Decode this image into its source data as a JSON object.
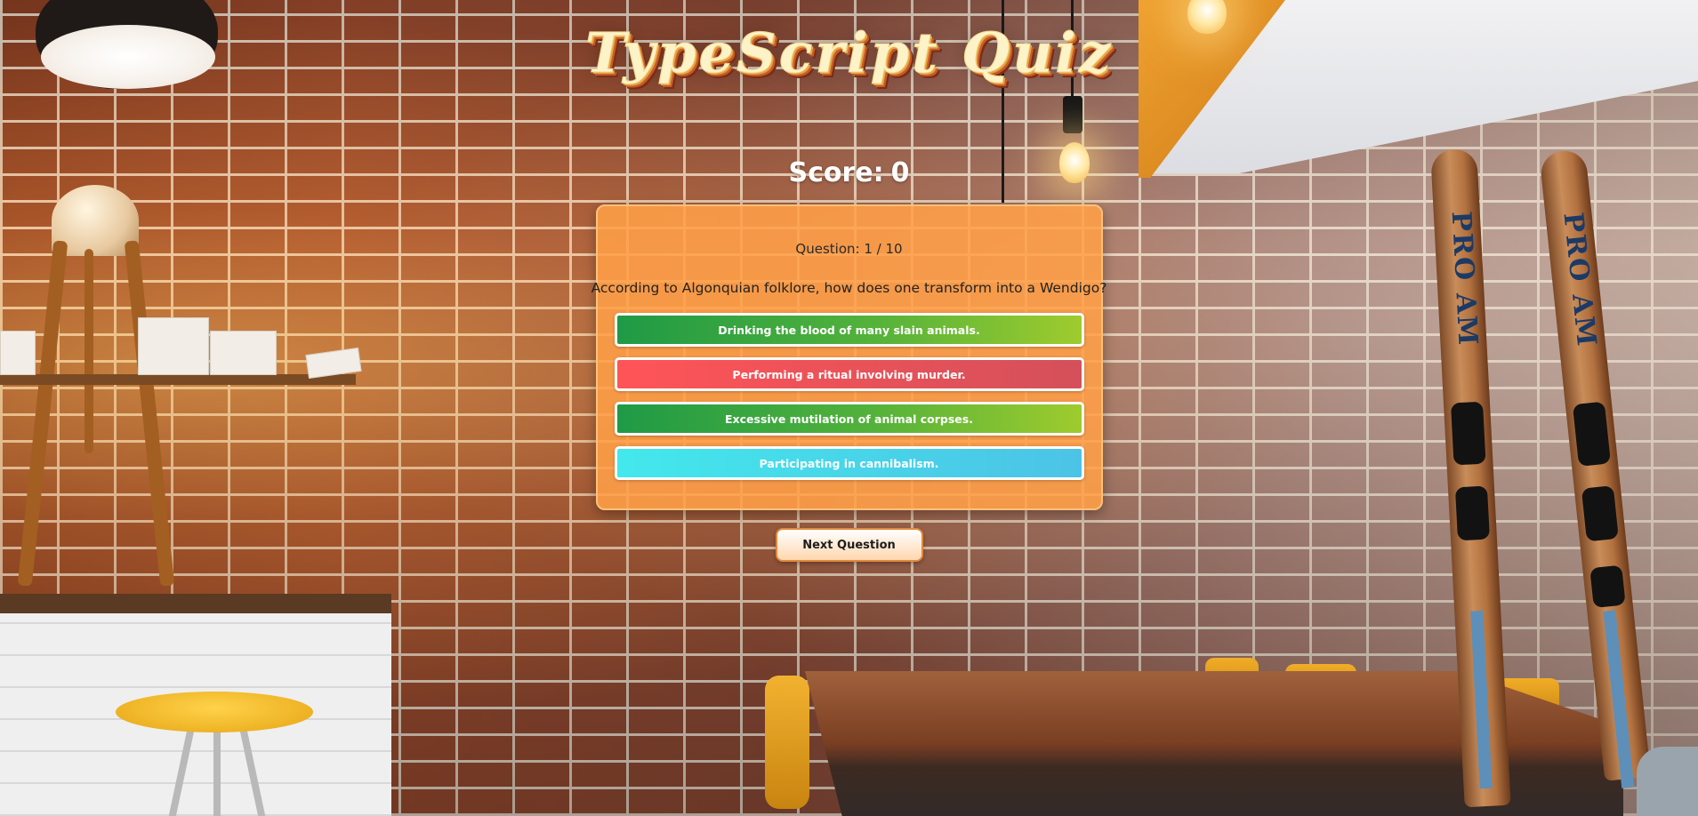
{
  "app": {
    "title": "TypeScript Quiz",
    "score_label": "Score:",
    "score_value": "0"
  },
  "question": {
    "counter": "Question: 1 / 10",
    "text": "According to Algonquian folklore, how does one transform into a Wendigo?",
    "answers": [
      {
        "label": "Drinking the blood of many slain animals.",
        "state": "correct"
      },
      {
        "label": "Performing a ritual involving murder.",
        "state": "wrong"
      },
      {
        "label": "Excessive mutilation of animal corpses.",
        "state": "correct"
      },
      {
        "label": "Participating in cannibalism.",
        "state": "unanswered"
      }
    ]
  },
  "controls": {
    "next_label": "Next Question"
  },
  "background": {
    "ski_brand": "PRO AM"
  },
  "colors": {
    "card": "#FF9F48",
    "answer_green": "#1F9A46",
    "answer_red": "#FF5458",
    "answer_cyan": "#43E8EC",
    "title_fill": "#FDF3C9"
  }
}
